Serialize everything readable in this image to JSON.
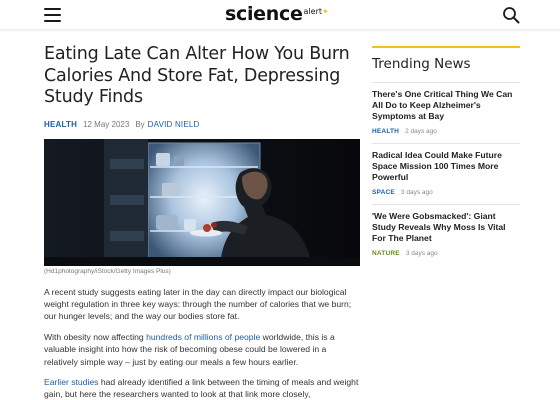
{
  "header": {
    "logo_main": "science",
    "logo_sub": "alert",
    "logo_mark": "✦",
    "menu_icon": "hamburger-menu-icon",
    "search_icon": "search-icon"
  },
  "article": {
    "title": "Eating Late Can Alter How You Burn Calories And Store Fat, Depressing Study Finds",
    "category": "HEALTH",
    "date": "12 May 2023",
    "by_label": "By",
    "author": "DAVID NIELD",
    "image_caption": "(Hd1photography/iStock/Getty Images Plus)",
    "p1": "A recent study suggests eating later in the day can directly impact our biological weight regulation in three key ways: through the number of calories that we burn; our hunger levels; and the way our bodies store fat.",
    "p2_pre": "With obesity now affecting ",
    "p2_link": "hundreds of millions of people",
    "p2_post": " worldwide, this is a valuable insight into how the risk of becoming obese could be lowered in a relatively simple way – just by eating our meals a few hours earlier.",
    "p3_link": "Earlier studies",
    "p3_post": " had already identified a link between the timing of meals and weight gain, but here the researchers wanted to look at that link more closely,"
  },
  "sidebar": {
    "title": "Trending News",
    "items": [
      {
        "headline": "There's One Critical Thing We Can All Do to Keep Alzheimer's Symptoms at Bay",
        "tag": "HEALTH",
        "tag_color": "#1d5fa8",
        "time": "2 days ago"
      },
      {
        "headline": "Radical Idea Could Make Future Space Mission 100 Times More Powerful",
        "tag": "SPACE",
        "tag_color": "#1d5fa8",
        "time": "3 days ago"
      },
      {
        "headline": "'We Were Gobsmacked': Giant Study Reveals Why Moss Is Vital For The Planet",
        "tag": "NATURE",
        "tag_color": "#6a8a1c",
        "time": "3 days ago"
      }
    ]
  },
  "colors": {
    "accent_yellow": "#f2c11d",
    "link_blue": "#1d5fa8"
  }
}
